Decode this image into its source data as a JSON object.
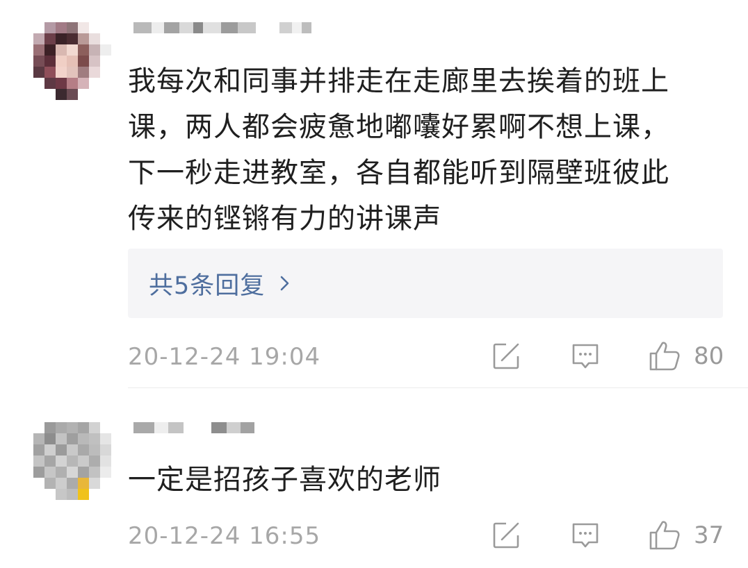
{
  "comments": [
    {
      "text_lines": [
        "我每次和同事并排走在走廊里去挨着的班上",
        "课，两人都会疲惫地嘟囔好累啊不想上课，",
        "下一秒走进教室，各自都能听到隔壁班彼此",
        "传来的铿锵有力的讲课声"
      ],
      "replies_label": "共5条回复",
      "timestamp": "20-12-24 19:04",
      "likes": "80"
    },
    {
      "text_lines": [
        "一定是招孩子喜欢的老师"
      ],
      "timestamp": "20-12-24 16:55",
      "likes": "37"
    }
  ],
  "icons": {
    "share": "share-icon",
    "reply": "comment-icon",
    "like": "thumbs-up-icon",
    "chevron": "chevron-right-icon"
  },
  "colors": {
    "reply_link": "#4e6e9e",
    "meta_text": "#a7a7a7",
    "reply_box_bg": "#f5f5f7"
  }
}
